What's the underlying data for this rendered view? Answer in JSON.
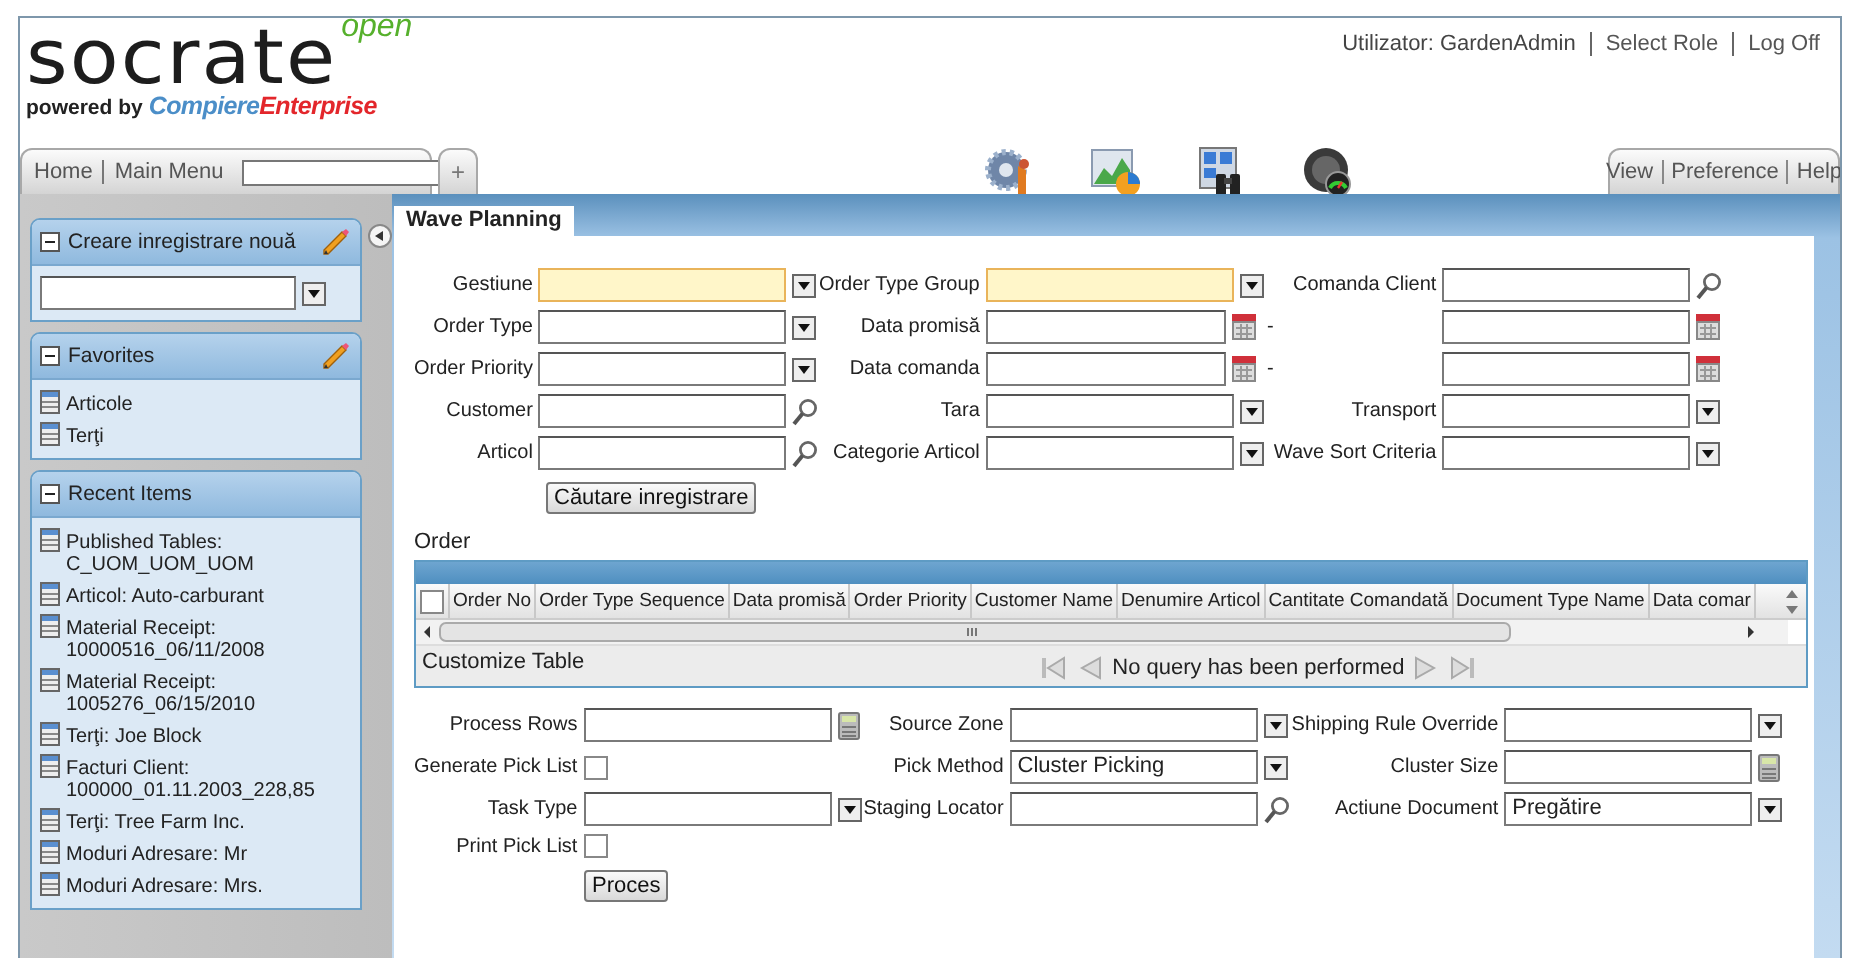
{
  "header": {
    "logo": {
      "name": "socrate",
      "edition": "open",
      "powered_by": "powered by",
      "brand_first": "Compiere",
      "brand_second": "Enterprise"
    },
    "user": "Utilizator: GardenAdmin",
    "links": [
      "Select Role",
      "Log Off"
    ]
  },
  "nav": {
    "links": [
      "Home",
      "Main Menu"
    ],
    "add_tab": "+",
    "right_links": [
      "View",
      "Preference",
      "Help"
    ]
  },
  "sidebar": {
    "panels": [
      {
        "kind": "create",
        "title": "Creare inregistrare nouă",
        "expanded": true,
        "editable": true
      },
      {
        "kind": "list",
        "title": "Favorites",
        "expanded": true,
        "editable": true,
        "items": [
          "Articole",
          "Terţi"
        ]
      },
      {
        "kind": "list",
        "title": "Recent Items",
        "expanded": true,
        "editable": false,
        "items": [
          "Published Tables: C_UOM_UOM_UOM",
          "Articol: Auto-carburant",
          "Material Receipt: 10000516_06/11/2008",
          "Material Receipt: 1005276_06/15/2010",
          "Terţi: Joe Block",
          "Facturi Client: 100000_01.11.2003_228,85",
          "Terţi: Tree Farm Inc.",
          "Moduri Adresare: Mr",
          "Moduri Adresare: Mrs."
        ]
      }
    ]
  },
  "tabs": [
    {
      "label": "Wave Planning",
      "selected": true
    }
  ],
  "search_form": {
    "rows": [
      [
        {
          "label": "Gestiune",
          "kind": "select",
          "mandatory": true
        },
        {
          "label": "Order Type Group",
          "kind": "select",
          "mandatory": true
        },
        {
          "label": "Comanda Client",
          "kind": "lookup",
          "mandatory": false
        }
      ],
      [
        {
          "label": "Order Type",
          "kind": "select",
          "mandatory": false
        },
        {
          "label": "Data promisă",
          "kind": "date",
          "mandatory": false,
          "suffix": "-"
        },
        {
          "kind": "date",
          "mandatory": false
        }
      ],
      [
        {
          "label": "Order Priority",
          "kind": "select",
          "mandatory": false
        },
        {
          "label": "Data comanda",
          "kind": "date",
          "mandatory": false,
          "suffix": "-"
        },
        {
          "kind": "date",
          "mandatory": false
        }
      ],
      [
        {
          "label": "Customer",
          "kind": "lookup",
          "mandatory": false
        },
        {
          "label": "Tara",
          "kind": "select",
          "mandatory": false
        },
        {
          "label": "Transport",
          "kind": "select",
          "mandatory": false
        }
      ],
      [
        {
          "label": "Articol",
          "kind": "lookup",
          "mandatory": false
        },
        {
          "label": "Categorie Articol",
          "kind": "select",
          "mandatory": false
        },
        {
          "label": "Wave Sort Criteria",
          "kind": "select",
          "mandatory": false
        }
      ]
    ],
    "button": "Căutare inregistrare"
  },
  "table": {
    "title": "Order",
    "select_all": {
      "checked": false
    },
    "columns": [
      "Order No",
      "Order Type Sequence",
      "Data promisă",
      "Order Priority",
      "Customer Name",
      "Denumire Articol",
      "Cantitate Comandată",
      "Document Type Name",
      "Data comar"
    ],
    "customize": "Customize Table",
    "status": "No query has been performed"
  },
  "process_form": {
    "rows": [
      [
        {
          "label": "Process Rows",
          "kind": "number",
          "mandatory": false
        },
        {
          "label": "Source Zone",
          "kind": "select",
          "mandatory": false
        },
        {
          "label": "Shipping Rule Override",
          "kind": "select",
          "mandatory": false
        }
      ],
      [
        {
          "label": "Generate Pick List",
          "kind": "checkbox",
          "checked": false
        },
        {
          "label": "Pick Method",
          "kind": "select",
          "mandatory": false,
          "value": "Cluster Picking"
        },
        {
          "label": "Cluster Size",
          "kind": "number",
          "mandatory": false
        }
      ],
      [
        {
          "label": "Task Type",
          "kind": "select",
          "mandatory": false
        },
        {
          "label": "Staging Locator",
          "kind": "lookup",
          "mandatory": false
        },
        {
          "label": "Actiune Document",
          "kind": "select",
          "mandatory": false,
          "value": "Pregătire"
        }
      ],
      [
        {
          "label": "Print Pick List",
          "kind": "checkbox",
          "checked": false
        }
      ]
    ],
    "button": "Proces"
  }
}
